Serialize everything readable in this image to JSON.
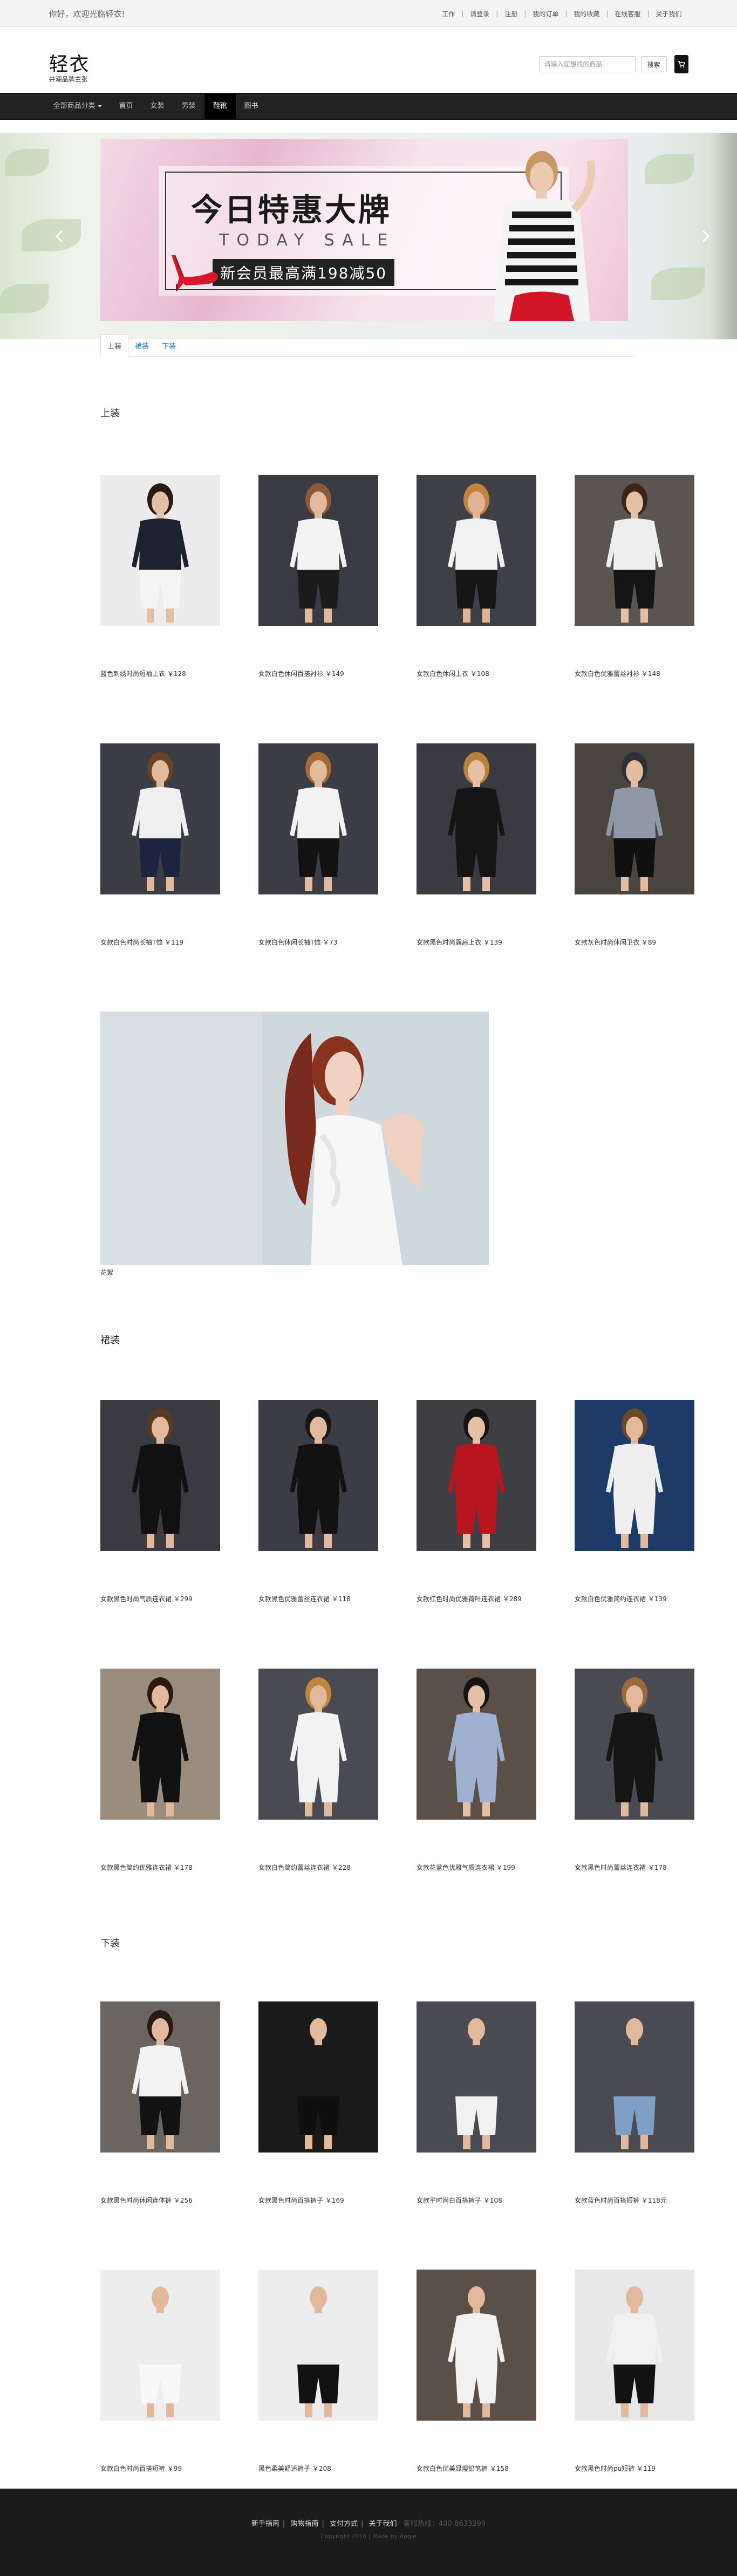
{
  "topbar": {
    "welcome": "你好，欢迎光临轻衣!",
    "links": [
      "工作",
      "请登录",
      "注册",
      "我的订单",
      "我的收藏",
      "在线客服",
      "关于我们"
    ]
  },
  "header": {
    "logo": "轻衣",
    "slogan": "井潮品牌主张",
    "search_placeholder": "请输入您想找的商品",
    "search_button": "搜索",
    "cart_icon": "cart-icon"
  },
  "nav": {
    "items": [
      "全部商品分类",
      "首页",
      "女装",
      "男装",
      "鞋靴",
      "图书"
    ],
    "active_index": 4
  },
  "banner": {
    "title": "今日特惠大牌",
    "subtitle": "TODAY SALE",
    "promo": "新会员最高满198减50"
  },
  "tabs": [
    "上装",
    "裙装",
    "下装"
  ],
  "sections": [
    {
      "title": "上装",
      "products": [
        {
          "caption": "蓝色刺绣时尚短袖上衣 ￥128",
          "bg": "#ececec",
          "top": "#1e2230",
          "bottom": "#f5f5f5",
          "skin": "#e3bfa6",
          "hair": "#2a1a12"
        },
        {
          "caption": "女款白色休闲百搭衬衫 ￥149",
          "bg": "#3a3a42",
          "top": "#f3f3f3",
          "bottom": "#1b1b1b",
          "skin": "#e2b99c",
          "hair": "#8a5a3a"
        },
        {
          "caption": "女款白色休闲上衣 ￥108",
          "bg": "#3e3f47",
          "top": "#f1f1f1",
          "bottom": "#161616",
          "skin": "#e0b497",
          "hair": "#c0843f"
        },
        {
          "caption": "女款白色优雅蕾丝衬衫 ￥148",
          "bg": "#5a5550",
          "top": "#eeeeee",
          "bottom": "#141414",
          "skin": "#e6c0a6",
          "hair": "#3b2418"
        },
        {
          "caption": "女款白色时尚长袖T恤 ￥119",
          "bg": "#3d3d45",
          "top": "#f0f0f0",
          "bottom": "#1c2440",
          "skin": "#e2b99c",
          "hair": "#6a4228"
        },
        {
          "caption": "女款白色休闲长袖T恤 ￥73",
          "bg": "#3c3c44",
          "top": "#f2f2f2",
          "bottom": "#121212",
          "skin": "#e2ba9e",
          "hair": "#a36a38"
        },
        {
          "caption": "女款黑色时尚露肩上衣 ￥139",
          "bg": "#3b3a40",
          "top": "#151515",
          "bottom": "#151515",
          "skin": "#e6c0a6",
          "hair": "#b9813f"
        },
        {
          "caption": "女款灰色时尚休闲卫衣 ￥89",
          "bg": "#4a4440",
          "top": "#8f98a6",
          "bottom": "#101010",
          "skin": "#e3bca2",
          "hair": "#2f2f36"
        }
      ],
      "feature": {
        "caption": "花絮"
      }
    },
    {
      "title": "裙装",
      "products": [
        {
          "caption": "女款黑色时尚气质连衣裙 ￥299",
          "bg": "#3a3a40",
          "top": "#111111",
          "bottom": "#111111",
          "skin": "#e2b99c",
          "hair": "#5a3a22"
        },
        {
          "caption": "女款黑色优雅蕾丝连衣裙 ￥118",
          "bg": "#3c3c44",
          "top": "#121212",
          "bottom": "#121212",
          "skin": "#e2b99c",
          "hair": "#161616"
        },
        {
          "caption": "女款红色时尚优雅荷叶连衣裙 ￥289",
          "bg": "#3f3e42",
          "top": "#b8161f",
          "bottom": "#b8161f",
          "skin": "#e6c0a6",
          "hair": "#141414"
        },
        {
          "caption": "女款白色优雅简约连衣裙 ￥139",
          "bg": "#1e3a66",
          "top": "#efefef",
          "bottom": "#efefef",
          "skin": "#e2b99c",
          "hair": "#6a4a2a"
        },
        {
          "caption": "女款黑色简约优雅连衣裙 ￥178",
          "bg": "#9a8d7e",
          "top": "#111111",
          "bottom": "#111111",
          "skin": "#e2b99c",
          "hair": "#2a1a12"
        },
        {
          "caption": "女款白色简约蕾丝连衣裙 ￥228",
          "bg": "#4a4a52",
          "top": "#f2f2f2",
          "bottom": "#f2f2f2",
          "skin": "#e2b99c",
          "hair": "#c0843f"
        },
        {
          "caption": "女款花蓝色优雅气质连衣裙 ￥199",
          "bg": "#5a5048",
          "top": "#9fb0d0",
          "bottom": "#9fb0d0",
          "skin": "#e6c0a6",
          "hair": "#141414"
        },
        {
          "caption": "女款黑色时尚蕾丝连衣裙 ￥178",
          "bg": "#4a4a52",
          "top": "#151515",
          "bottom": "#151515",
          "skin": "#e2b99c",
          "hair": "#9a6a3a"
        }
      ]
    },
    {
      "title": "下装",
      "products": [
        {
          "caption": "女款黑色时尚休闲连体裤 ￥256",
          "bg": "#6a6560",
          "top": "#f2f2f2",
          "bottom": "#121212",
          "skin": "#e2b99c",
          "hair": "#2a1a12"
        },
        {
          "caption": "女款黑色时尚百搭裤子 ￥169",
          "bg": "#1a1a1a",
          "top": "#1a1a1a",
          "bottom": "#0f0f0f",
          "skin": "#e2b99c",
          "hair": "#1a1a1a"
        },
        {
          "caption": "女款平时尚白百搭裤子 ￥108",
          "bg": "#4a4a52",
          "top": "#4a4a52",
          "bottom": "#f1f1f1",
          "skin": "#e2b99c",
          "hair": "#4a4a52"
        },
        {
          "caption": "女款蓝色时尚百搭短裤 ￥118元",
          "bg": "#4a4a52",
          "top": "#4a4a52",
          "bottom": "#7fa0c4",
          "skin": "#e2b99c",
          "hair": "#4a4a52"
        },
        {
          "caption": "女款白色时尚百搭短裤 ￥99",
          "bg": "#ededed",
          "top": "#ededed",
          "bottom": "#f8f8f8",
          "skin": "#e2b99c",
          "hair": "#ededed"
        },
        {
          "caption": "黑色柔美舒适裤子 ￥208",
          "bg": "#ededed",
          "top": "#ededed",
          "bottom": "#111111",
          "skin": "#e2b99c",
          "hair": "#ededed"
        },
        {
          "caption": "女款白色优美显瘦铅笔裤 ￥158",
          "bg": "#5a5048",
          "top": "#f1f1f1",
          "bottom": "#f1f1f1",
          "skin": "#e2b99c",
          "hair": "#5a5048"
        },
        {
          "caption": "女款黑色时尚pu短裤 ￥119",
          "bg": "#e8e8e8",
          "top": "#f1f1f1",
          "bottom": "#121212",
          "skin": "#e2b99c",
          "hair": "#e8e8e8"
        }
      ]
    }
  ],
  "footer": {
    "links": [
      "新手指南",
      "购物指南",
      "支付方式",
      "关于我们"
    ],
    "tel": "客服热线：400-8633399",
    "copyright": "Copyright 2016 | Made by Angie"
  }
}
